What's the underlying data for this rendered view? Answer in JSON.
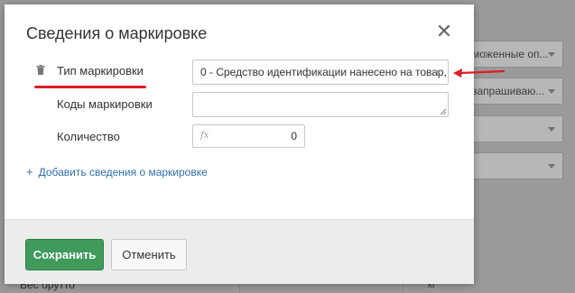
{
  "background": {
    "fields": [
      "моженные оп...",
      "запрашиваю...",
      "",
      ""
    ],
    "bottom_label": "Вес брутто",
    "bottom_unit": "кг"
  },
  "modal": {
    "title": "Сведения о маркировке",
    "close_icon": "close-icon",
    "marking_type": {
      "label": "Тип маркировки",
      "value": "0 - Средство идентификации нанесено на товар,..."
    },
    "marking_codes": {
      "label": "Коды маркировки",
      "value": ""
    },
    "quantity": {
      "label": "Количество",
      "fx_icon": "fx",
      "value": "0"
    },
    "add_link": "Добавить сведения о маркировке"
  },
  "footer": {
    "save_label": "Сохранить",
    "cancel_label": "Отменить"
  },
  "colors": {
    "accent_green": "#3f9a5b",
    "link_blue": "#2e6fb0",
    "annotation_red": "#d91f26"
  }
}
